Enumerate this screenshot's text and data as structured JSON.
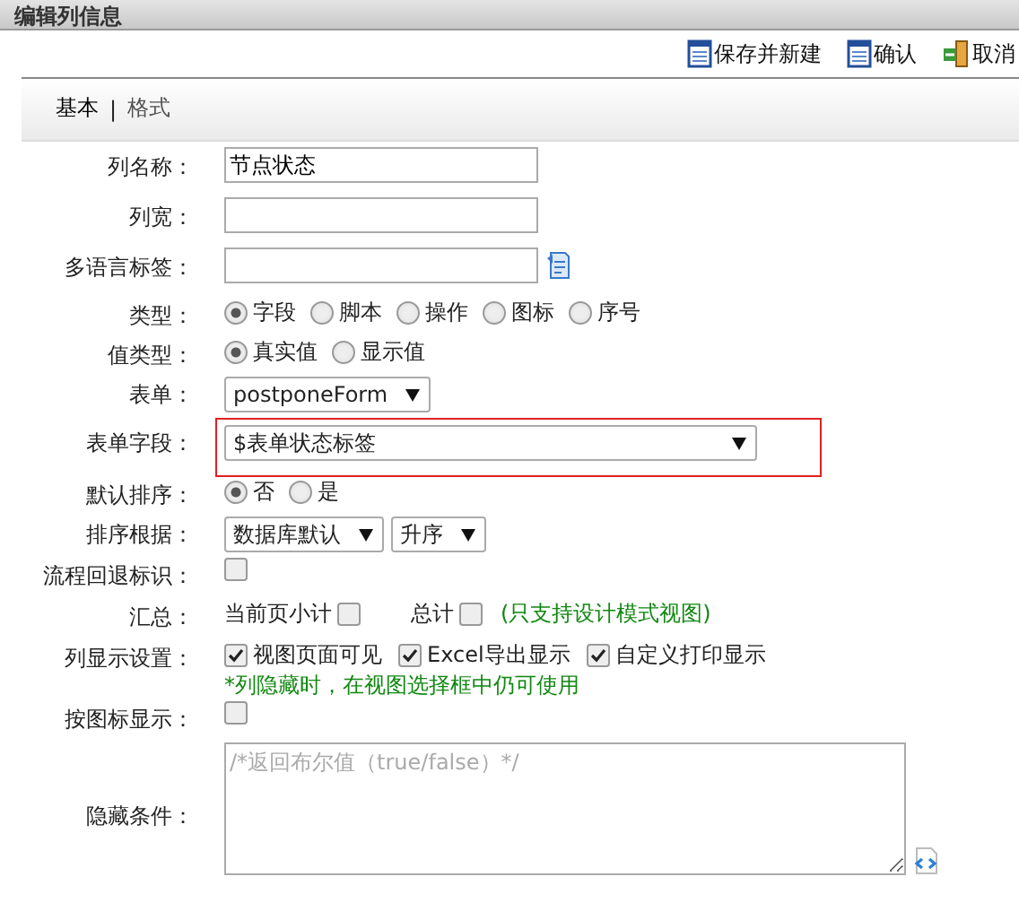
{
  "window": {
    "title": "编辑列信息"
  },
  "toolbar": [
    {
      "label": "保存并新建",
      "kind": "save"
    },
    {
      "label": "确认",
      "kind": "save"
    },
    {
      "label": "取消",
      "kind": "exit"
    }
  ],
  "tabs": [
    {
      "label": "基本",
      "selected": true
    },
    {
      "label": "格式",
      "selected": false
    }
  ],
  "tab_separator": "|",
  "fields": [
    {
      "kind": "text",
      "label": "列名称：",
      "value": "节点状态"
    },
    {
      "kind": "text",
      "label": "列宽："
    },
    {
      "kind": "text",
      "label": "多语言标签：",
      "lang_icon": true
    },
    {
      "kind": "radio",
      "label": "类型：",
      "options": [
        {
          "label": "字段",
          "selected": true
        },
        {
          "label": "脚本",
          "selected": false
        },
        {
          "label": "操作",
          "selected": false
        },
        {
          "label": "图标",
          "selected": false
        },
        {
          "label": "序号",
          "selected": false
        }
      ]
    },
    {
      "kind": "radio",
      "label": "值类型：",
      "options": [
        {
          "label": "真实值",
          "selected": true
        },
        {
          "label": "显示值",
          "selected": false
        }
      ]
    },
    {
      "kind": "select",
      "label": "表单：",
      "selects": [
        {
          "value": "postponeForm"
        }
      ]
    },
    {
      "kind": "select",
      "label": "表单字段：",
      "highlighted": true,
      "selects": [
        {
          "value": "$表单状态标签"
        }
      ]
    },
    {
      "kind": "radio",
      "label": "默认排序：",
      "options": [
        {
          "label": "否",
          "selected": true
        },
        {
          "label": "是",
          "selected": false
        }
      ]
    },
    {
      "kind": "select",
      "label": "排序根据：",
      "selects": [
        {
          "value": "数据库默认"
        },
        {
          "value": "升序"
        }
      ]
    },
    {
      "kind": "checks",
      "label": "流程回退标识：",
      "checks": [
        {
          "checked": false
        }
      ]
    },
    {
      "kind": "summary",
      "label": "汇总：",
      "checks": [
        {
          "label": "当前页小计",
          "checked": false
        },
        {
          "label": "总计",
          "checked": false
        }
      ],
      "note": "(只支持设计模式视图)"
    },
    {
      "kind": "checks",
      "label": "列显示设置：",
      "checks": [
        {
          "label": "视图页面可见",
          "checked": true
        },
        {
          "label": "Excel导出显示",
          "checked": true
        },
        {
          "label": "自定义打印显示",
          "checked": true
        }
      ],
      "note": "*列隐藏时，在视图选择框中仍可使用"
    },
    {
      "kind": "checks",
      "label": "按图标显示：",
      "checks": [
        {
          "checked": false
        }
      ]
    },
    {
      "kind": "textarea",
      "label": "隐藏条件：",
      "placeholder": "/*返回布尔值（true/false）*/"
    }
  ]
}
